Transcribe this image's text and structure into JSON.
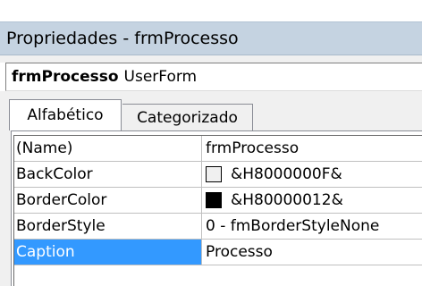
{
  "window": {
    "title": "Propriedades - frmProcesso"
  },
  "object_selector": {
    "name": "frmProcesso",
    "type": "UserForm"
  },
  "tabs": [
    {
      "label": "Alfabético",
      "active": true
    },
    {
      "label": "Categorizado",
      "active": false
    }
  ],
  "properties": [
    {
      "name": "(Name)",
      "value": "frmProcesso"
    },
    {
      "name": "BackColor",
      "value": "&H8000000F&",
      "swatch": "#f0f0f0"
    },
    {
      "name": "BorderColor",
      "value": "&H80000012&",
      "swatch": "#000000"
    },
    {
      "name": "BorderStyle",
      "value": "0 - fmBorderStyleNone"
    },
    {
      "name": "Caption",
      "value": "Processo",
      "selected": true
    }
  ],
  "colors": {
    "titlebar": "#c5d3e1",
    "selection": "#3399ff",
    "panel": "#f0f0f0"
  }
}
